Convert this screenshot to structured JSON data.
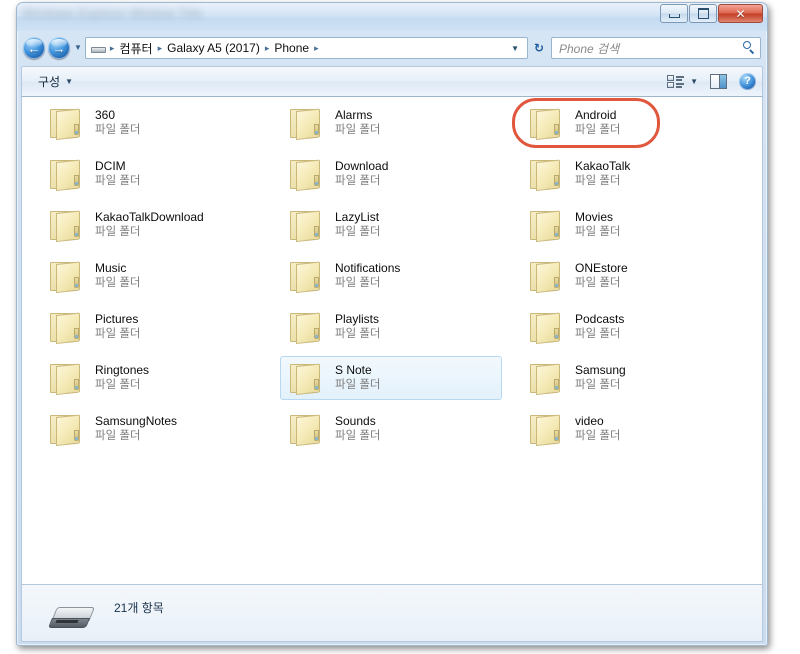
{
  "window": {
    "title_blurred_text": "Windows Explorer Window Title",
    "controls": {
      "minimize_label": "",
      "maximize_label": "",
      "close_label": "✕"
    }
  },
  "address_bar": {
    "back_arrow": "←",
    "forward_arrow": "→",
    "history_caret": "▼",
    "computer_icon": "computer-icon",
    "breadcrumbs": [
      "컴퓨터",
      "Galaxy A5 (2017)",
      "Phone"
    ],
    "separator": "▸",
    "dropdown_caret": "▼",
    "refresh_label": "↻"
  },
  "search": {
    "placeholder": "Phone 검색",
    "icon": "search-icon"
  },
  "toolbar": {
    "organize_label": "구성",
    "organize_caret": "▼",
    "view_caret": "▼",
    "help_label": "?"
  },
  "status_bar": {
    "item_count": "21개 항목",
    "device_icon": "drive-icon"
  },
  "colors": {
    "annotation": "#e0573e",
    "selection_border": "#b7d8ef",
    "folder_body": "#f4e9b4"
  },
  "files": {
    "type_label": "파일 폴더",
    "items": [
      {
        "name": "360",
        "type": "파일 폴더",
        "col": 0,
        "row": 0,
        "selected": false,
        "annotated": false
      },
      {
        "name": "Alarms",
        "type": "파일 폴더",
        "col": 1,
        "row": 0,
        "selected": false,
        "annotated": false
      },
      {
        "name": "Android",
        "type": "파일 폴더",
        "col": 2,
        "row": 0,
        "selected": false,
        "annotated": true
      },
      {
        "name": "DCIM",
        "type": "파일 폴더",
        "col": 0,
        "row": 1,
        "selected": false,
        "annotated": false
      },
      {
        "name": "Download",
        "type": "파일 폴더",
        "col": 1,
        "row": 1,
        "selected": false,
        "annotated": false
      },
      {
        "name": "KakaoTalk",
        "type": "파일 폴더",
        "col": 2,
        "row": 1,
        "selected": false,
        "annotated": false
      },
      {
        "name": "KakaoTalkDownload",
        "type": "파일 폴더",
        "col": 0,
        "row": 2,
        "selected": false,
        "annotated": false
      },
      {
        "name": "LazyList",
        "type": "파일 폴더",
        "col": 1,
        "row": 2,
        "selected": false,
        "annotated": false
      },
      {
        "name": "Movies",
        "type": "파일 폴더",
        "col": 2,
        "row": 2,
        "selected": false,
        "annotated": false
      },
      {
        "name": "Music",
        "type": "파일 폴더",
        "col": 0,
        "row": 3,
        "selected": false,
        "annotated": false
      },
      {
        "name": "Notifications",
        "type": "파일 폴더",
        "col": 1,
        "row": 3,
        "selected": false,
        "annotated": false
      },
      {
        "name": "ONEstore",
        "type": "파일 폴더",
        "col": 2,
        "row": 3,
        "selected": false,
        "annotated": false
      },
      {
        "name": "Pictures",
        "type": "파일 폴더",
        "col": 0,
        "row": 4,
        "selected": false,
        "annotated": false
      },
      {
        "name": "Playlists",
        "type": "파일 폴더",
        "col": 1,
        "row": 4,
        "selected": false,
        "annotated": false
      },
      {
        "name": "Podcasts",
        "type": "파일 폴더",
        "col": 2,
        "row": 4,
        "selected": false,
        "annotated": false
      },
      {
        "name": "Ringtones",
        "type": "파일 폴더",
        "col": 0,
        "row": 5,
        "selected": false,
        "annotated": false
      },
      {
        "name": "S Note",
        "type": "파일 폴더",
        "col": 1,
        "row": 5,
        "selected": true,
        "annotated": false
      },
      {
        "name": "Samsung",
        "type": "파일 폴더",
        "col": 2,
        "row": 5,
        "selected": false,
        "annotated": false
      },
      {
        "name": "SamsungNotes",
        "type": "파일 폴더",
        "col": 0,
        "row": 6,
        "selected": false,
        "annotated": false
      },
      {
        "name": "Sounds",
        "type": "파일 폴더",
        "col": 1,
        "row": 6,
        "selected": false,
        "annotated": false
      },
      {
        "name": "video",
        "type": "파일 폴더",
        "col": 2,
        "row": 6,
        "selected": false,
        "annotated": false
      }
    ]
  }
}
